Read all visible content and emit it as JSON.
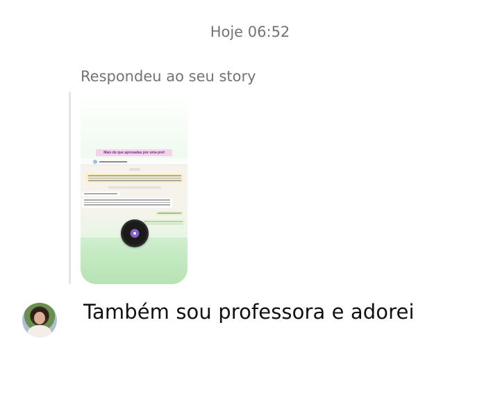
{
  "thread": {
    "timestamp": "Hoje 06:52"
  },
  "story_reply": {
    "label": "Respondeu ao seu story",
    "story_caption": "Mais do que aprovadas por uma prof"
  },
  "message": {
    "text": "Também sou professora e adorei"
  },
  "colors": {
    "secondary_text": "#737373",
    "story_gradient_bottom": "#b6e3b4"
  },
  "icons": {
    "vinyl": "vinyl-record-icon",
    "avatar": "user-avatar"
  }
}
